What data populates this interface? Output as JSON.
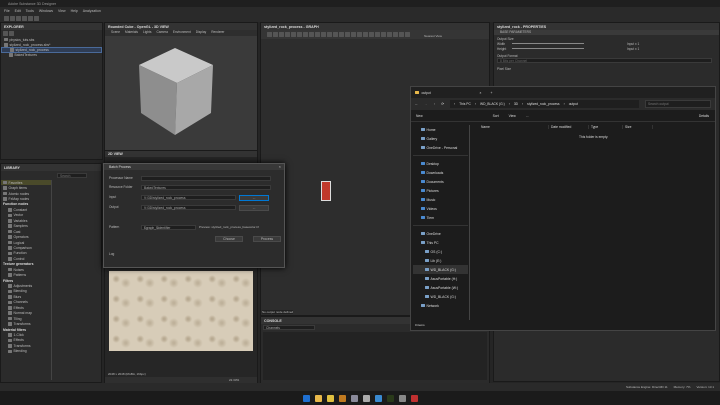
{
  "app": {
    "title": "Adobe Substance 3D Designer",
    "menu": [
      "File",
      "Edit",
      "Tools",
      "Windows",
      "View",
      "Help",
      "Analyzation"
    ]
  },
  "explorer": {
    "title": "EXPLORER",
    "items": [
      {
        "label": "physics_tuts.sbs"
      },
      {
        "label": "stylized_rock_process.sbs*"
      },
      {
        "label": "stylized_rock_process",
        "selected": true
      },
      {
        "label": "BakedTextures"
      }
    ]
  },
  "view3d": {
    "title": "Rounded Cube - OpenGL - 3D VIEW",
    "menu": [
      "Scene",
      "Materials",
      "Lights",
      "Camera",
      "Environment",
      "Display",
      "Renderer"
    ]
  },
  "view2d": {
    "title": "2D VIEW",
    "status": "2048 x 2048 (RGBA, 16bpc)",
    "zoom": "22.33%"
  },
  "library": {
    "title": "LIBRARY",
    "search_placeholder": "Search",
    "items": [
      {
        "label": "Favorites",
        "type": "item",
        "highlight": true
      },
      {
        "label": "Graph items",
        "type": "item"
      },
      {
        "label": "Atomic nodes",
        "type": "item"
      },
      {
        "label": "FxMap nodes",
        "type": "item"
      },
      {
        "label": "Function nodes",
        "type": "section"
      },
      {
        "label": "Constant"
      },
      {
        "label": "Vector"
      },
      {
        "label": "Variables"
      },
      {
        "label": "Samplers"
      },
      {
        "label": "Cast"
      },
      {
        "label": "Operators"
      },
      {
        "label": "Logical"
      },
      {
        "label": "Comparison"
      },
      {
        "label": "Function"
      },
      {
        "label": "Control"
      },
      {
        "label": "Texture generators",
        "type": "section"
      },
      {
        "label": "Noises"
      },
      {
        "label": "Patterns"
      },
      {
        "label": "Filters",
        "type": "section"
      },
      {
        "label": "Adjustments"
      },
      {
        "label": "Blending"
      },
      {
        "label": "Blurs"
      },
      {
        "label": "Channels"
      },
      {
        "label": "Effects"
      },
      {
        "label": "Normal map"
      },
      {
        "label": "Tiling"
      },
      {
        "label": "Transforms"
      },
      {
        "label": "Material filters",
        "type": "section"
      },
      {
        "label": "1-Click"
      },
      {
        "label": "Effects"
      },
      {
        "label": "Transforms"
      },
      {
        "label": "Blending"
      }
    ]
  },
  "graph": {
    "title": "stylized_rock_process - GRAPH",
    "view_mode": "Nearest View",
    "no_output": "No output node defined"
  },
  "console": {
    "title": "CONSOLE",
    "filter": "Channels"
  },
  "properties": {
    "title": "stylized_rock - PROPERTIES",
    "section": "BASE PARAMETERS",
    "output_size": "Output Size",
    "width": "Width",
    "height": "Height",
    "width_val": "Input x 1",
    "height_val": "Input x 1",
    "output_format": "Output Format",
    "format_val": "8 Bits per Channel",
    "pixel_size": "Pixel Size"
  },
  "dialog": {
    "title": "Batch Process",
    "processor_label": "Processor Name",
    "processor_value": "",
    "resource_label": "Resource Folder",
    "resource_value": "BakedTextures",
    "input_label": "Input",
    "input_value": "V:\\3D\\stylized_rock_process",
    "output_label": "Output",
    "output_value": "V:\\3D\\stylized_rock_process",
    "browse": "...",
    "pattern_label": "Pattern",
    "pattern_value": "$graph_$identifier",
    "preview": "Preview: stylized_rock_process_basecolor.tif",
    "choose": "Choose",
    "process": "Process",
    "log": "Log"
  },
  "file_explorer": {
    "tab": "output",
    "breadcrumb": [
      "This PC",
      "WD_BLACK (G:)",
      "3D",
      "stylized_rock_process",
      "output"
    ],
    "search_placeholder": "Search output",
    "toolbar": {
      "new": "New",
      "sort": "Sort",
      "view": "View",
      "more": "...",
      "details": "Details"
    },
    "columns": [
      "Name",
      "Date modified",
      "Type",
      "Size"
    ],
    "empty": "This folder is empty.",
    "status": "0 items",
    "nav": [
      {
        "label": "Home",
        "g": 1
      },
      {
        "label": "Gallery",
        "g": 1
      },
      {
        "label": "OneDrive - Personal",
        "g": 1
      },
      {
        "label": "Desktop",
        "g": 2
      },
      {
        "label": "Downloads",
        "g": 2
      },
      {
        "label": "Documents",
        "g": 2
      },
      {
        "label": "Pictures",
        "g": 2
      },
      {
        "label": "Music",
        "g": 2
      },
      {
        "label": "Videos",
        "g": 2
      },
      {
        "label": "Tiem",
        "g": 2
      },
      {
        "label": "OneDrive",
        "g": 3
      },
      {
        "label": "This PC",
        "g": 3
      },
      {
        "label": "OS (C:)",
        "g": 3
      },
      {
        "label": "Lib (E:)",
        "g": 3
      },
      {
        "label": "WD_BLACK (G:)",
        "g": 3,
        "sel": true
      },
      {
        "label": "AsusPortable (H:)",
        "g": 3
      },
      {
        "label": "AsusPortable (W:)",
        "g": 3
      },
      {
        "label": "WD_BLACK (G:)",
        "g": 3
      },
      {
        "label": "Network",
        "g": 3
      }
    ]
  },
  "statusbar": {
    "engine": "Substance Engine: Direct3D 11",
    "memory": "Memory: 7%",
    "version": "Version: 13.1"
  },
  "taskbar": {
    "apps": [
      "start",
      "file-explorer",
      "chrome",
      "substance-designer",
      "substance-painter",
      "app",
      "photoshop",
      "premiere",
      "app2",
      "davinci"
    ]
  },
  "colors": {
    "accent": "#0078d4",
    "node": "#c0392b"
  }
}
